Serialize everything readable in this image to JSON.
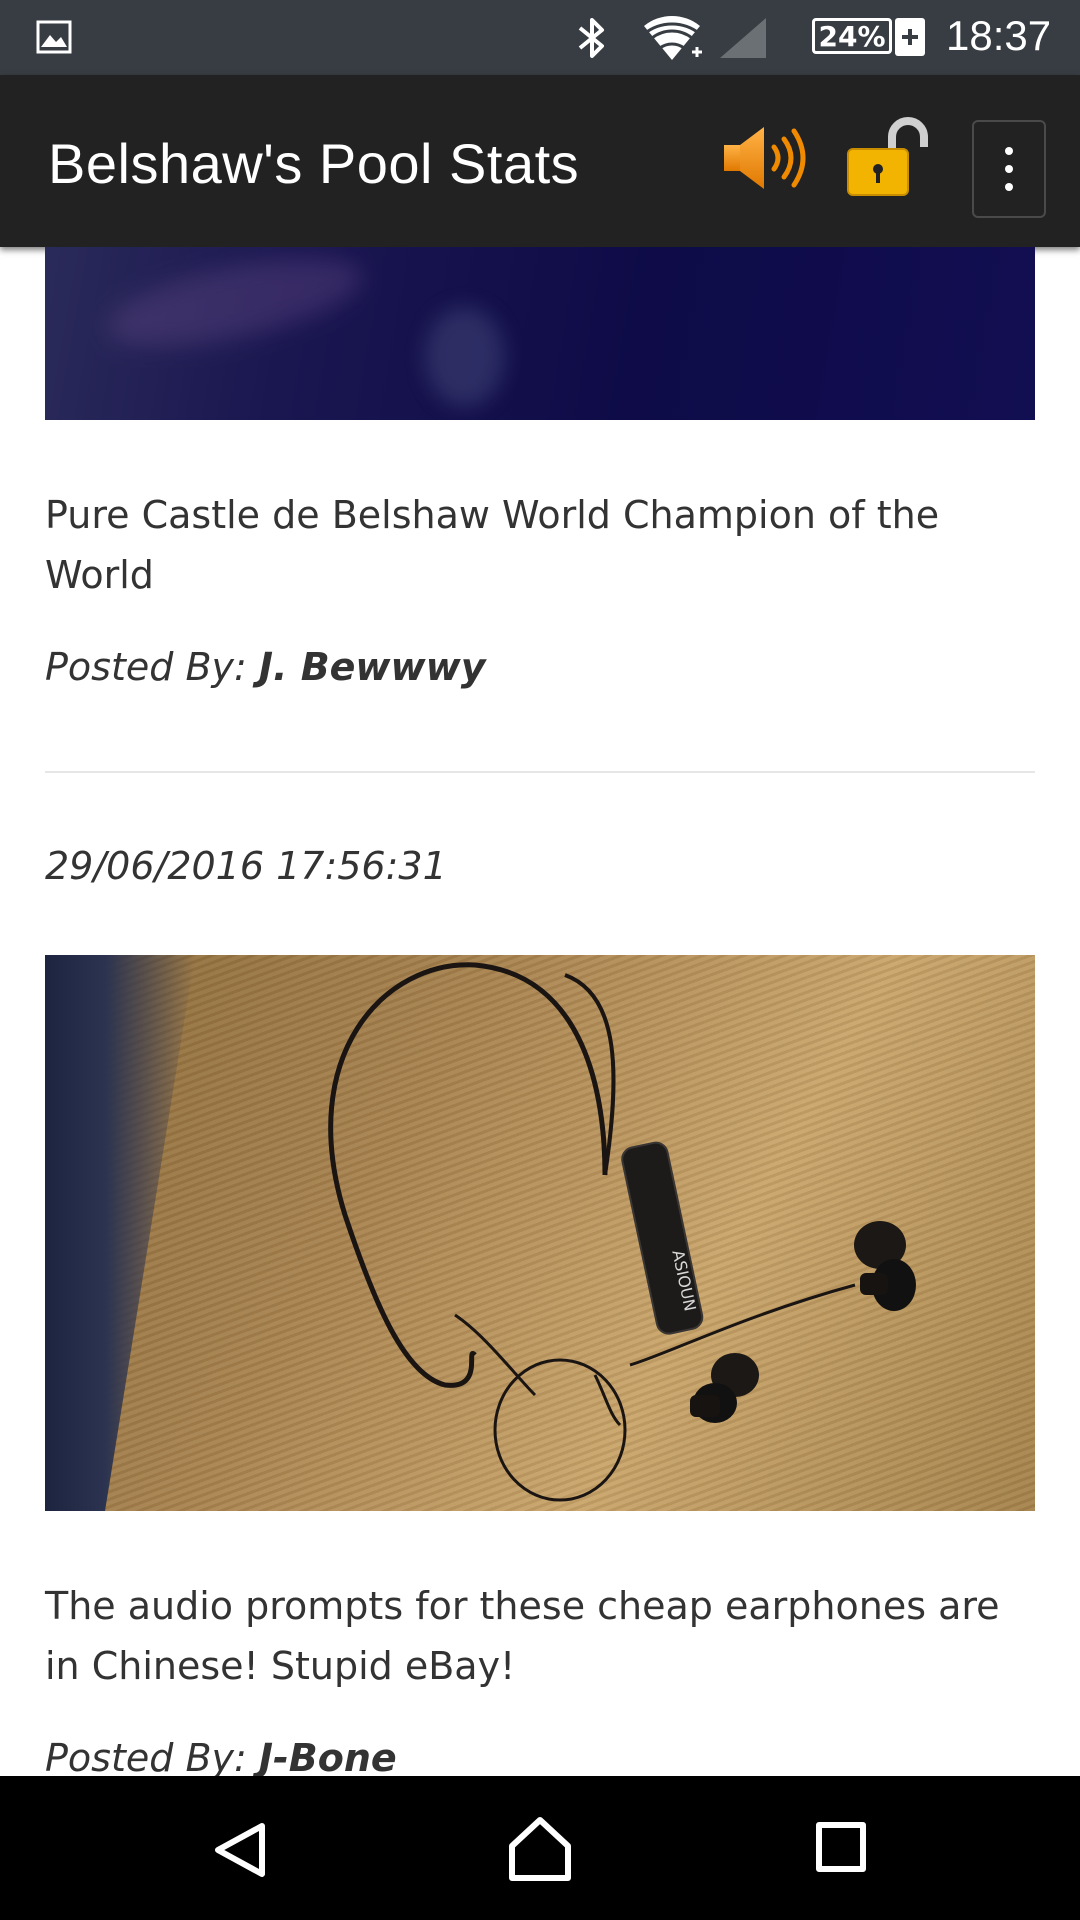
{
  "status_bar": {
    "battery_percent": "24%",
    "time": "18:37",
    "icons": [
      "gallery-icon",
      "bluetooth-icon",
      "wifi-icon",
      "cell-signal-icon",
      "battery-icon",
      "charging-plus-icon"
    ]
  },
  "app_bar": {
    "title": "Belshaw's Pool Stats",
    "actions": [
      "speaker-icon",
      "unlocked-padlock-icon",
      "overflow-menu-icon"
    ]
  },
  "feed": {
    "posts": [
      {
        "caption": "Pure Castle de Belshaw World Champion of the World",
        "posted_by_label": "Posted By: ",
        "author": "J. Bewwwy"
      },
      {
        "timestamp": "29/06/2016 17:56:31",
        "image_label": "ASIOUN",
        "caption": "The audio prompts for these cheap earphones are in Chinese! Stupid eBay!",
        "posted_by_label": "Posted By: ",
        "author": "J-Bone"
      }
    ]
  },
  "nav_bar": {
    "buttons": [
      "back-icon",
      "home-icon",
      "recents-icon"
    ]
  }
}
